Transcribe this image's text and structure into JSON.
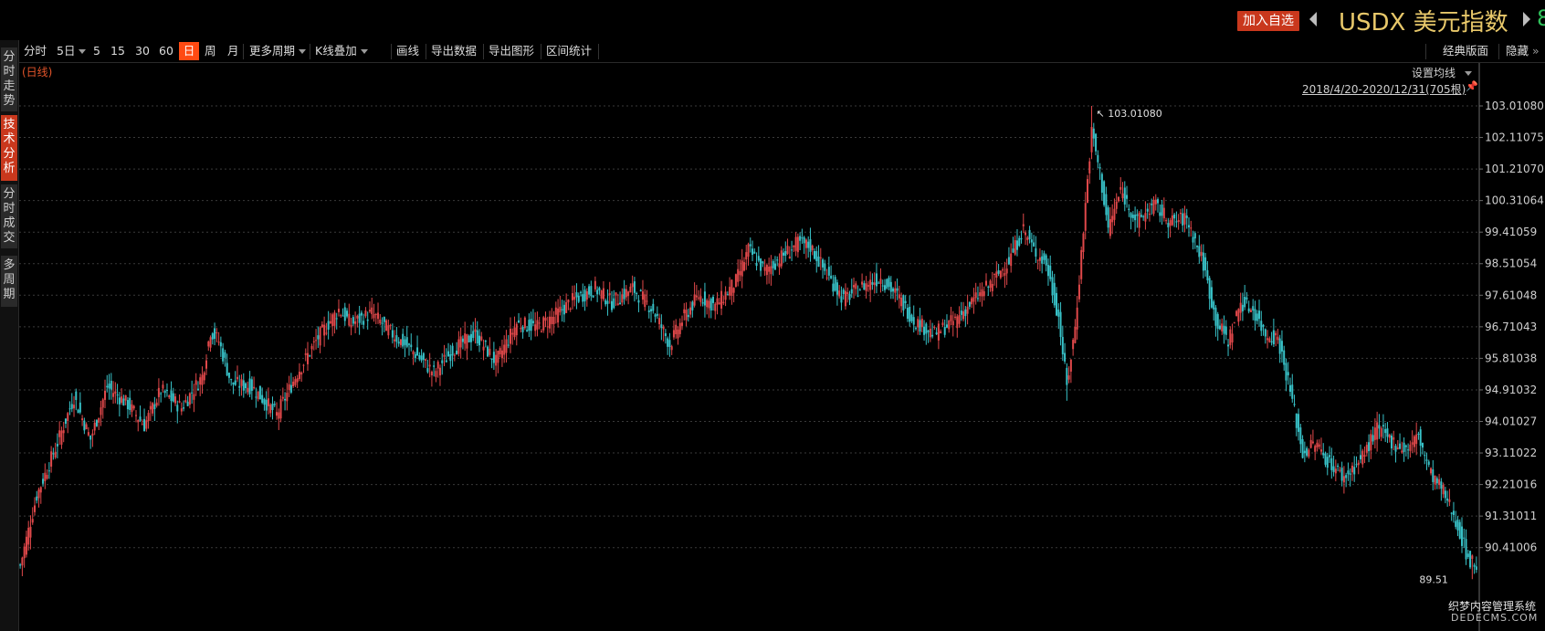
{
  "header": {
    "add_button": "加入自选",
    "title": "USDX 美元指数",
    "edge_value": "8"
  },
  "side_tabs": [
    "分时走势",
    "技术分析",
    "分时成交",
    "多周期"
  ],
  "toolbar": {
    "items": [
      "分时",
      "5日",
      "5",
      "15",
      "30",
      "60",
      "日",
      "周",
      "月",
      "更多周期",
      "K线叠加",
      "画线",
      "导出数据",
      "导出图形",
      "区间统计"
    ],
    "active": "日",
    "right_items": [
      "经典版面",
      "隐藏"
    ]
  },
  "labels": {
    "period": "(日线)",
    "ma_setting": "设置均线",
    "range": "2018/4/20-2020/12/31(705根)",
    "max_label": "103.01080",
    "min_label": "89.51"
  },
  "watermark": {
    "line1": "织梦内容管理系统",
    "line2": "DEDECMS.COM"
  },
  "colors": {
    "up": "#e0484a",
    "down": "#38c2c8",
    "accent": "#c9381d",
    "title": "#e8c86a"
  },
  "chart_data": {
    "type": "candlestick",
    "title": "USDX 美元指数",
    "subtitle": "(日线)",
    "y_ticks": [
      "103.01080",
      "102.11075",
      "101.21070",
      "100.31064",
      "99.41059",
      "98.51054",
      "97.61048",
      "96.71043",
      "95.81038",
      "94.91032",
      "94.01027",
      "93.11022",
      "92.21016",
      "91.31011",
      "90.41006"
    ],
    "ylim": [
      89.51,
      103.0108
    ],
    "grid": true,
    "count": 705,
    "high": 103.0108,
    "low": 89.51,
    "keyframes": [
      [
        0,
        89.9
      ],
      [
        8,
        91.9
      ],
      [
        18,
        93.4
      ],
      [
        26,
        94.7
      ],
      [
        34,
        93.5
      ],
      [
        42,
        95.0
      ],
      [
        52,
        94.5
      ],
      [
        60,
        93.9
      ],
      [
        68,
        94.9
      ],
      [
        78,
        94.4
      ],
      [
        88,
        95.3
      ],
      [
        92,
        96.6
      ],
      [
        96,
        96.3
      ],
      [
        102,
        95.1
      ],
      [
        112,
        95.0
      ],
      [
        124,
        94.2
      ],
      [
        134,
        95.4
      ],
      [
        144,
        96.4
      ],
      [
        154,
        97.2
      ],
      [
        160,
        96.8
      ],
      [
        170,
        97.1
      ],
      [
        180,
        96.5
      ],
      [
        190,
        96.0
      ],
      [
        200,
        95.4
      ],
      [
        210,
        96.1
      ],
      [
        220,
        96.5
      ],
      [
        230,
        95.7
      ],
      [
        240,
        96.8
      ],
      [
        250,
        96.7
      ],
      [
        258,
        97.0
      ],
      [
        268,
        97.5
      ],
      [
        278,
        97.8
      ],
      [
        286,
        97.4
      ],
      [
        296,
        97.8
      ],
      [
        306,
        97.2
      ],
      [
        314,
        96.2
      ],
      [
        320,
        96.9
      ],
      [
        328,
        97.6
      ],
      [
        336,
        97.3
      ],
      [
        346,
        98.0
      ],
      [
        352,
        98.9
      ],
      [
        360,
        98.3
      ],
      [
        368,
        98.7
      ],
      [
        376,
        99.1
      ],
      [
        382,
        99.0
      ],
      [
        390,
        98.2
      ],
      [
        398,
        97.5
      ],
      [
        408,
        97.9
      ],
      [
        416,
        98.1
      ],
      [
        424,
        97.6
      ],
      [
        432,
        96.9
      ],
      [
        442,
        96.5
      ],
      [
        452,
        96.9
      ],
      [
        460,
        97.4
      ],
      [
        470,
        98.0
      ],
      [
        478,
        98.6
      ],
      [
        485,
        99.5
      ],
      [
        490,
        98.9
      ],
      [
        496,
        98.5
      ],
      [
        502,
        97.0
      ],
      [
        506,
        95.0
      ],
      [
        510,
        96.7
      ],
      [
        514,
        99.5
      ],
      [
        518,
        102.3
      ],
      [
        522,
        101.1
      ],
      [
        526,
        99.5
      ],
      [
        532,
        100.6
      ],
      [
        540,
        99.7
      ],
      [
        548,
        100.2
      ],
      [
        556,
        99.7
      ],
      [
        564,
        99.8
      ],
      [
        572,
        98.5
      ],
      [
        578,
        96.9
      ],
      [
        584,
        96.3
      ],
      [
        590,
        97.4
      ],
      [
        596,
        97.2
      ],
      [
        602,
        96.5
      ],
      [
        608,
        96.4
      ],
      [
        614,
        94.9
      ],
      [
        620,
        93.1
      ],
      [
        626,
        93.4
      ],
      [
        632,
        92.9
      ],
      [
        640,
        92.4
      ],
      [
        648,
        92.9
      ],
      [
        656,
        93.8
      ],
      [
        664,
        93.4
      ],
      [
        670,
        93.2
      ],
      [
        676,
        93.6
      ],
      [
        682,
        92.5
      ],
      [
        688,
        92.0
      ],
      [
        694,
        91.2
      ],
      [
        700,
        90.1
      ],
      [
        704,
        89.9
      ]
    ],
    "spikes": [
      {
        "index": 518,
        "high": 103.0108
      },
      {
        "index": 506,
        "low": 94.6
      }
    ]
  }
}
